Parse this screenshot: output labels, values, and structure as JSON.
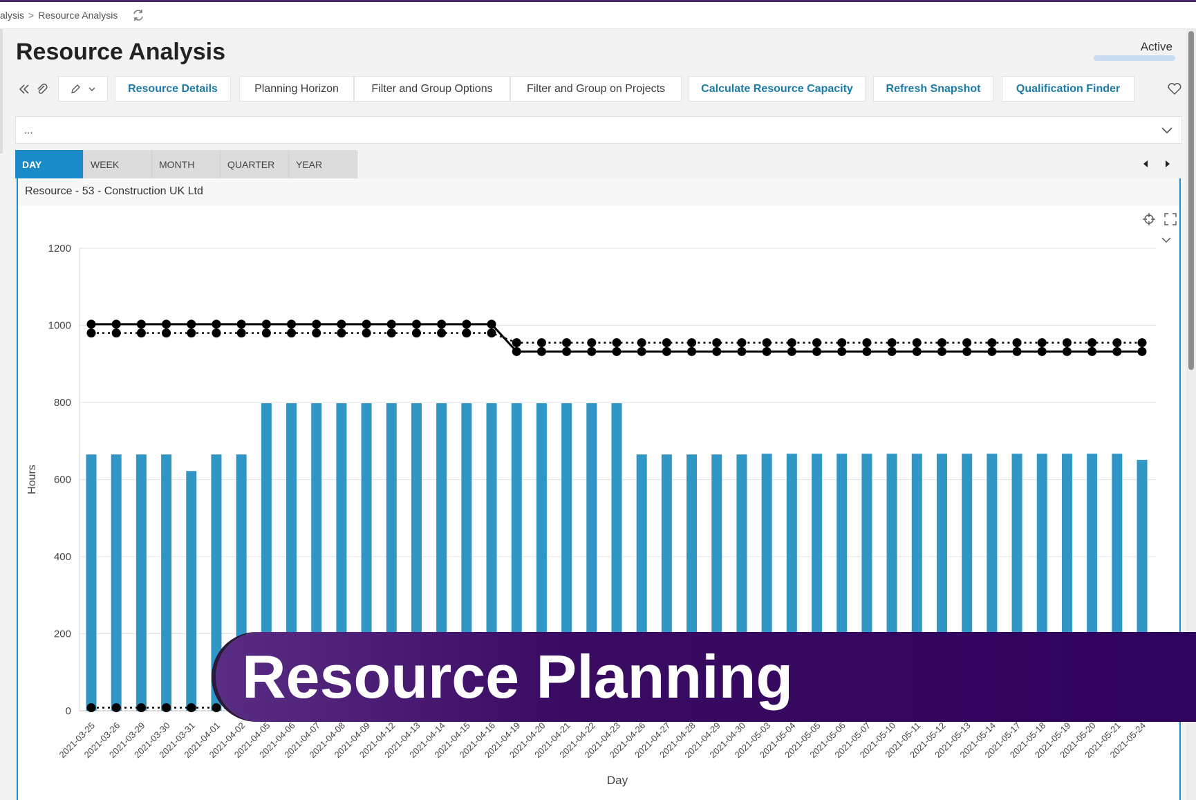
{
  "breadcrumb": {
    "parent": "alysis",
    "current": "Resource Analysis",
    "refresh_icon": "refresh-icon"
  },
  "page": {
    "title": "Resource Analysis",
    "status": "Active"
  },
  "toolbar": {
    "collapse_icon": "double-chevron-left-icon",
    "attach_icon": "paperclip-icon",
    "dropdown_icon": "edit-pen-icon",
    "buttons": [
      {
        "label": "Resource Details",
        "style": "primary"
      },
      {
        "label": "Planning Horizon",
        "style": "plain"
      },
      {
        "label": "Filter and Group Options",
        "style": "plain"
      },
      {
        "label": "Filter and Group on Projects",
        "style": "plain"
      },
      {
        "label": "Calculate Resource Capacity",
        "style": "primary"
      },
      {
        "label": "Refresh Snapshot",
        "style": "primary"
      },
      {
        "label": "Qualification Finder",
        "style": "primary"
      }
    ],
    "favorite_icon": "heart-icon"
  },
  "filter": {
    "text": "..."
  },
  "periods": {
    "tabs": [
      "DAY",
      "WEEK",
      "MONTH",
      "QUARTER",
      "YEAR"
    ],
    "active": "DAY"
  },
  "panel": {
    "title": "Resource - 53 - Construction UK Ltd"
  },
  "chart_data": {
    "type": "bar",
    "title": "",
    "xlabel": "Day",
    "ylabel": "Hours",
    "ylim": [
      0,
      1200
    ],
    "yticks": [
      0,
      200,
      400,
      600,
      800,
      1000,
      1200
    ],
    "grid": true,
    "categories": [
      "2021-03-25",
      "2021-03-26",
      "2021-03-29",
      "2021-03-30",
      "2021-03-31",
      "2021-04-01",
      "2021-04-02",
      "2021-04-05",
      "2021-04-06",
      "2021-04-07",
      "2021-04-08",
      "2021-04-09",
      "2021-04-12",
      "2021-04-13",
      "2021-04-14",
      "2021-04-15",
      "2021-04-16",
      "2021-04-19",
      "2021-04-20",
      "2021-04-21",
      "2021-04-22",
      "2021-04-23",
      "2021-04-26",
      "2021-04-27",
      "2021-04-28",
      "2021-04-29",
      "2021-04-30",
      "2021-05-03",
      "2021-05-04",
      "2021-05-05",
      "2021-05-06",
      "2021-05-07",
      "2021-05-10",
      "2021-05-11",
      "2021-05-12",
      "2021-05-13",
      "2021-05-14",
      "2021-05-17",
      "2021-05-18",
      "2021-05-19",
      "2021-05-20",
      "2021-05-21",
      "2021-05-24"
    ],
    "series": [
      {
        "kind": "bar",
        "color": "#2f96c6",
        "values": [
          665,
          665,
          665,
          665,
          622,
          665,
          665,
          798,
          798,
          798,
          798,
          798,
          798,
          798,
          798,
          798,
          798,
          798,
          798,
          798,
          798,
          798,
          665,
          665,
          665,
          665,
          665,
          667,
          667,
          667,
          667,
          667,
          667,
          667,
          667,
          667,
          667,
          667,
          667,
          667,
          667,
          667,
          651
        ]
      },
      {
        "kind": "line",
        "style": "solid",
        "color": "#000000",
        "values": [
          1003,
          1003,
          1003,
          1003,
          1003,
          1003,
          1003,
          1003,
          1003,
          1003,
          1003,
          1003,
          1003,
          1003,
          1003,
          1003,
          1003,
          932,
          932,
          932,
          932,
          932,
          932,
          932,
          932,
          932,
          932,
          932,
          932,
          932,
          932,
          932,
          932,
          932,
          932,
          932,
          932,
          932,
          932,
          932,
          932,
          932,
          932
        ]
      },
      {
        "kind": "line",
        "style": "dotted",
        "color": "#000000",
        "values": [
          980,
          980,
          980,
          980,
          980,
          980,
          980,
          980,
          980,
          980,
          980,
          980,
          980,
          980,
          980,
          980,
          980,
          955,
          955,
          955,
          955,
          955,
          955,
          955,
          955,
          955,
          955,
          955,
          955,
          955,
          955,
          955,
          955,
          955,
          955,
          955,
          955,
          955,
          955,
          955,
          955,
          955,
          955
        ]
      },
      {
        "kind": "line",
        "style": "dotted",
        "color": "#000000",
        "values": [
          8,
          8,
          8,
          8,
          8,
          8,
          8,
          8,
          8,
          8,
          8,
          8,
          8,
          8,
          8,
          8,
          8,
          8,
          8,
          8,
          8,
          8,
          8,
          8,
          8,
          8,
          8,
          8,
          8,
          8,
          8,
          8,
          8,
          8,
          8,
          8,
          8,
          8,
          8,
          8,
          8,
          8,
          8
        ]
      }
    ]
  },
  "chart_controls": [
    "crosshair-icon",
    "expand-icon",
    "chevron-down-icon"
  ],
  "banner": {
    "text": "Resource Planning"
  }
}
